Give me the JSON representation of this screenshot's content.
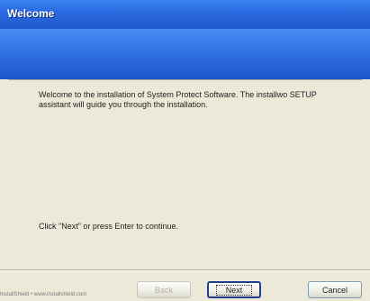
{
  "window": {
    "title": "Welcome"
  },
  "content": {
    "intro": "Welcome to the installation of System Protect Software. The installwo SETUP assistant will guide you through the installation.",
    "prompt": "Click \"Next\" or press Enter to continue."
  },
  "footer": {
    "link_text": "InstallShield • www.installshield.com"
  },
  "buttons": {
    "back": "Back",
    "next": "Next",
    "cancel": "Cancel"
  }
}
